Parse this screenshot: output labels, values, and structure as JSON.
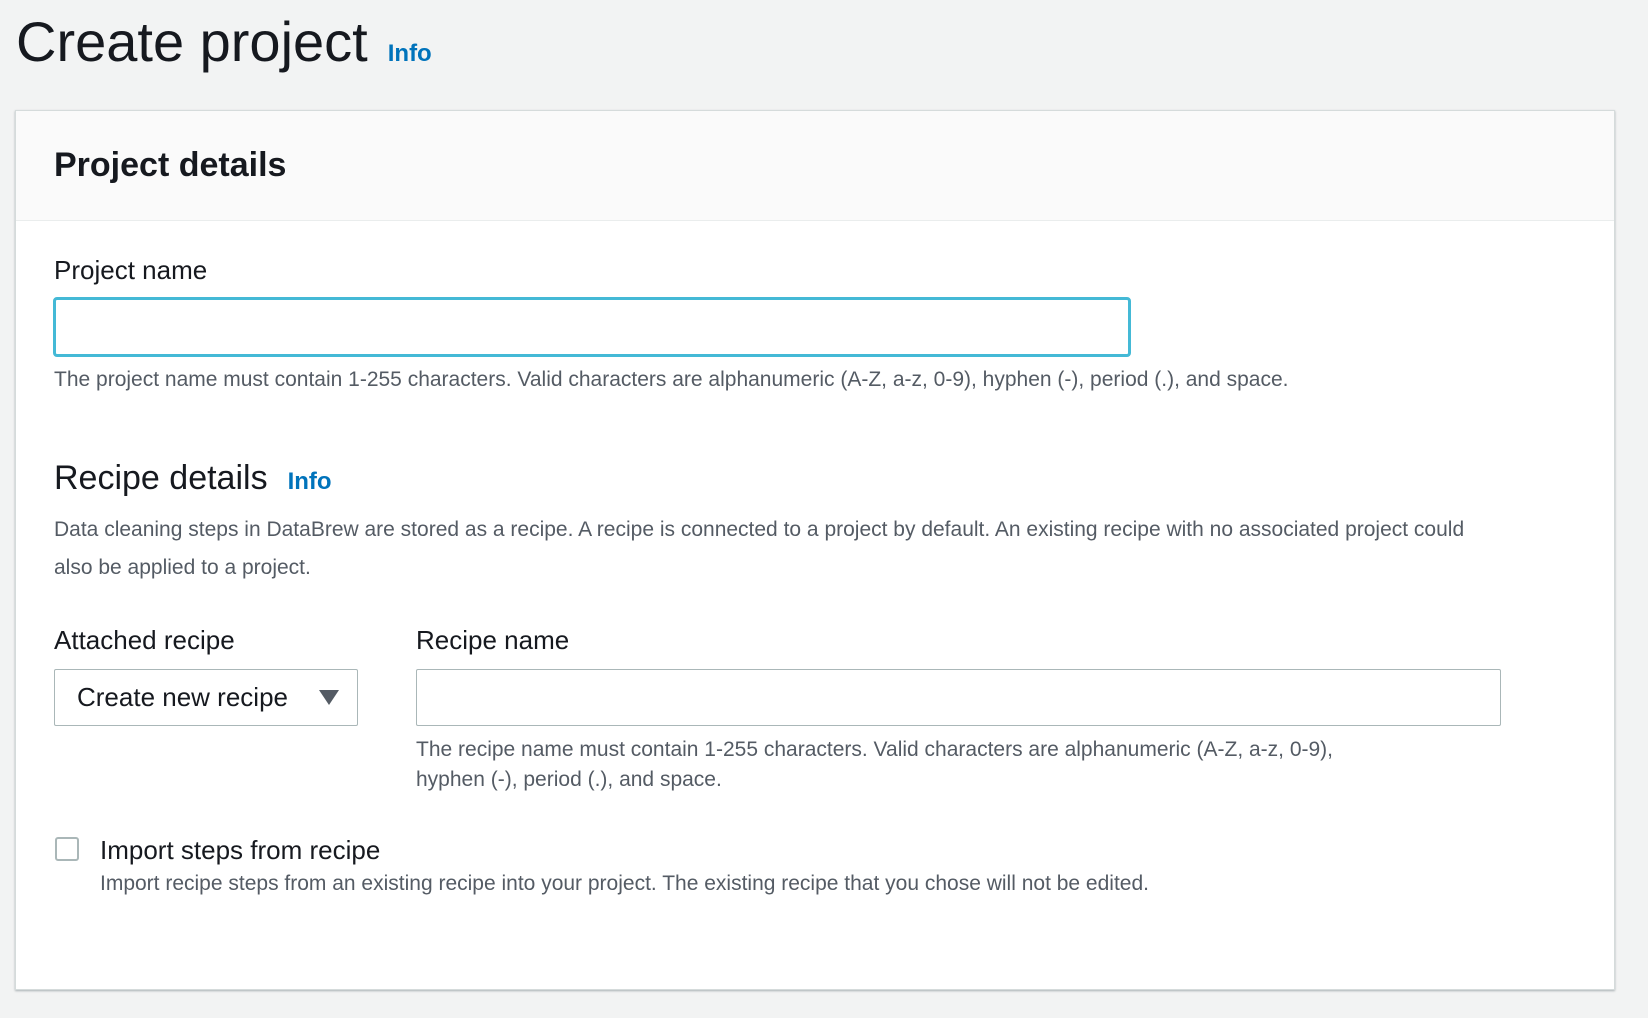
{
  "header": {
    "title": "Create project",
    "info_link": "Info"
  },
  "project_details": {
    "title": "Project details",
    "project_name": {
      "label": "Project name",
      "value": "",
      "placeholder": "",
      "hint": "The project name must contain 1-255 characters. Valid characters are alphanumeric (A-Z, a-z, 0-9), hyphen (-), period (.), and space."
    }
  },
  "recipe_details": {
    "title": "Recipe details",
    "info_link": "Info",
    "description": "Data cleaning steps in DataBrew are stored as a recipe. A recipe is connected to a project by default. An existing recipe with no associated project could also be applied to a project.",
    "attached_recipe": {
      "label": "Attached recipe",
      "selected": "Create new recipe",
      "icon": "caret-down-icon"
    },
    "recipe_name": {
      "label": "Recipe name",
      "value": "",
      "hint_line1": "The recipe name must contain 1-255 characters. Valid characters are alphanumeric (A-Z, a-z, 0-9),",
      "hint_line2": "hyphen (-), period (.), and space."
    },
    "import_steps": {
      "label": "Import steps from recipe",
      "checked": false,
      "description": "Import recipe steps from an existing recipe into your project. The existing recipe that you chose will not be edited."
    }
  },
  "colors": {
    "link": "#0073bb",
    "focus_ring": "#44b9d6",
    "background": "#f2f3f3",
    "hint_text": "#545b64"
  }
}
